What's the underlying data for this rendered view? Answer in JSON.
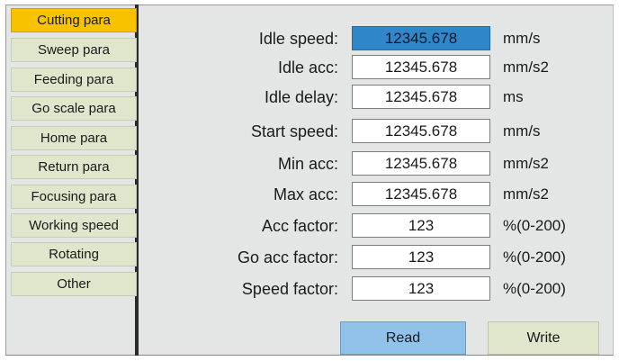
{
  "sidebar": {
    "items": [
      {
        "label": "Cutting para"
      },
      {
        "label": "Sweep para"
      },
      {
        "label": "Feeding para"
      },
      {
        "label": "Go scale para"
      },
      {
        "label": "Home para"
      },
      {
        "label": "Return para"
      },
      {
        "label": "Focusing para"
      },
      {
        "label": "Working speed"
      },
      {
        "label": "Rotating"
      },
      {
        "label": "Other"
      }
    ],
    "active_index": 0
  },
  "params": [
    {
      "label": "Idle speed:",
      "value": "12345.678",
      "unit": "mm/s"
    },
    {
      "label": "Idle acc:",
      "value": "12345.678",
      "unit": "mm/s2"
    },
    {
      "label": "Idle delay:",
      "value": "12345.678",
      "unit": "ms"
    },
    {
      "label": "Start speed:",
      "value": "12345.678",
      "unit": "mm/s"
    },
    {
      "label": "Min acc:",
      "value": "12345.678",
      "unit": "mm/s2"
    },
    {
      "label": "Max acc:",
      "value": "12345.678",
      "unit": "mm/s2"
    },
    {
      "label": "Acc factor:",
      "value": "123",
      "unit": "%(0-200)"
    },
    {
      "label": "Go acc factor:",
      "value": "123",
      "unit": "%(0-200)"
    },
    {
      "label": "Speed factor:",
      "value": "123",
      "unit": "%(0-200)"
    }
  ],
  "actions": {
    "read_label": "Read",
    "write_label": "Write"
  },
  "colors": {
    "active_tab": "#f7c200",
    "tab_bg": "#dfe6cc",
    "active_field": "#2f86c8",
    "read_button": "#90c2ea",
    "panel_bg": "#e4e6e6"
  }
}
